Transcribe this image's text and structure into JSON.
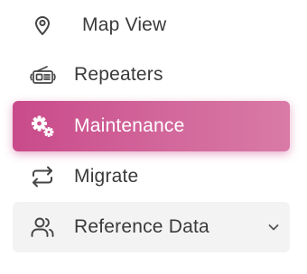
{
  "sidebar": {
    "items": [
      {
        "label": "Map View",
        "icon": "location-pin-icon",
        "active": false
      },
      {
        "label": "Repeaters",
        "icon": "radio-repeater-icon",
        "active": false
      },
      {
        "label": "Maintenance",
        "icon": "gears-icon",
        "active": true
      },
      {
        "label": "Migrate",
        "icon": "swap-arrows-icon",
        "active": false
      },
      {
        "label": "Reference Data",
        "icon": "users-icon",
        "active": false,
        "expandable": true
      }
    ]
  },
  "colors": {
    "active_start": "#c94a8a",
    "active_end": "#d97aa6",
    "text": "#3a3a3a",
    "icon": "#444444",
    "group_background": "#f3f3f3"
  }
}
